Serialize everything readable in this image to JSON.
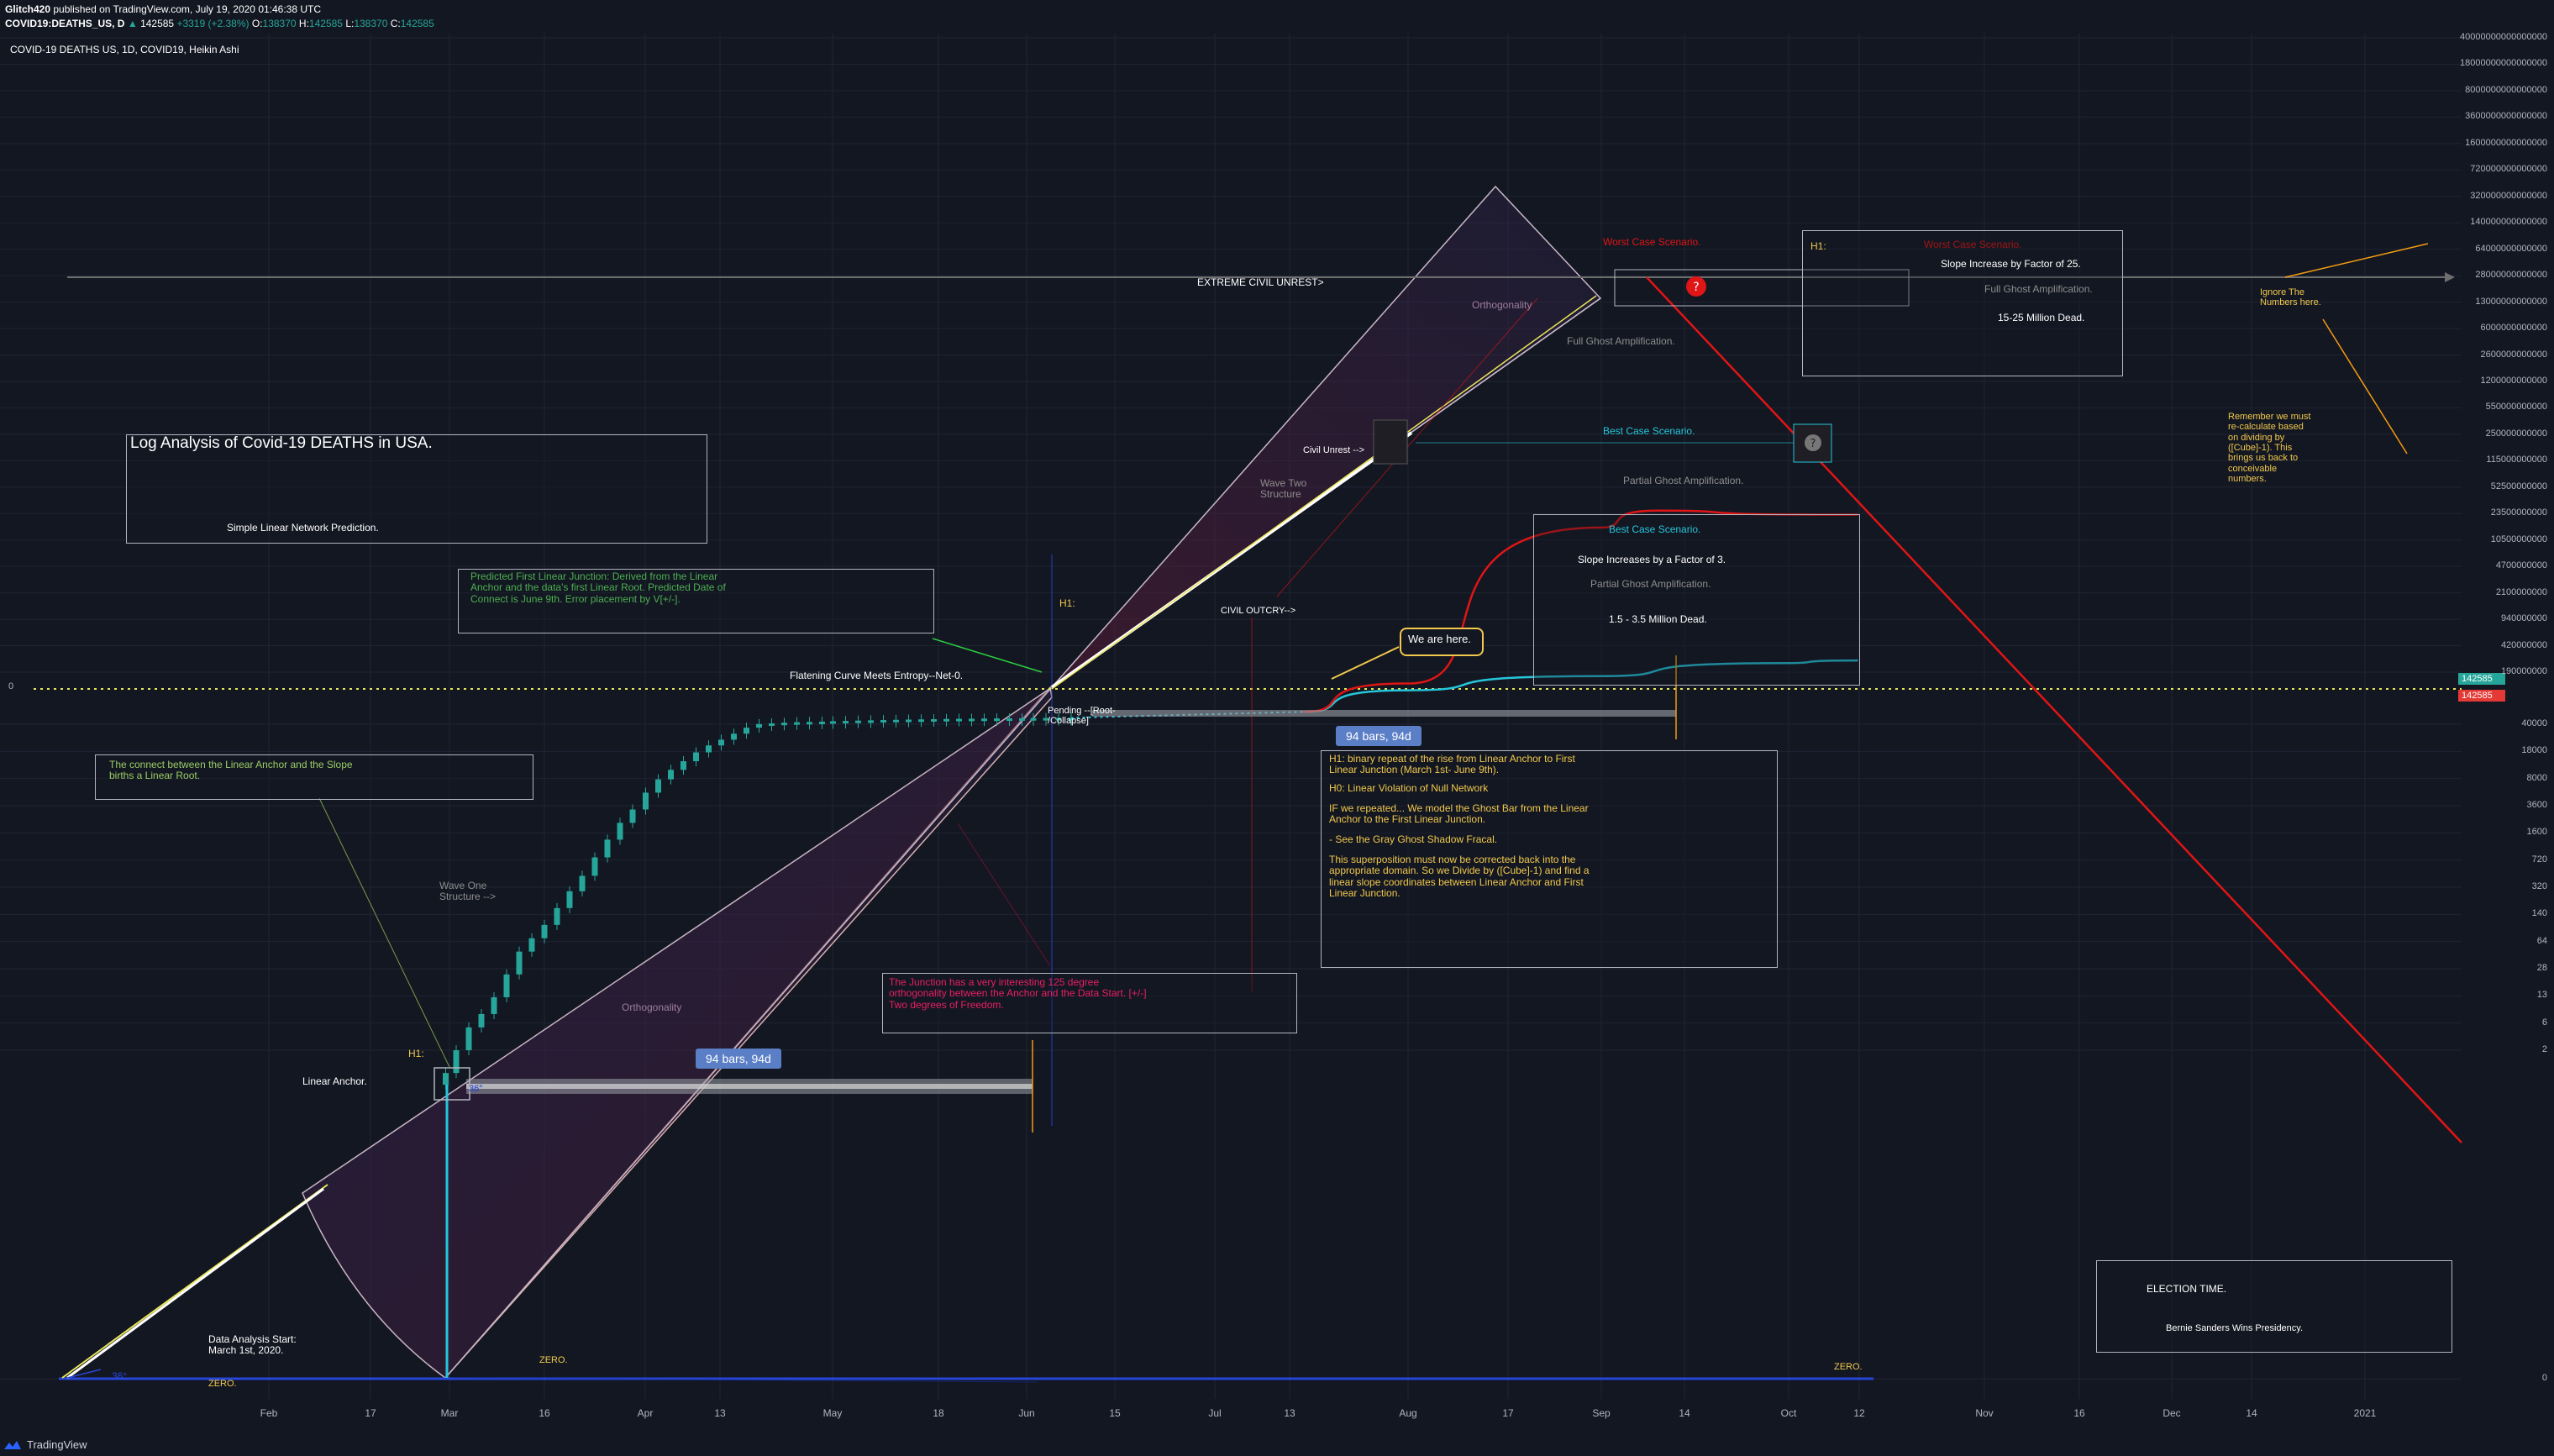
{
  "header": {
    "user": "Glitch420",
    "published": "published on TradingView.com, July 19, 2020 01:46:38 UTC",
    "symbol": "COVID19:DEATHS_US, D",
    "last": "142585",
    "change": "+3319 (+2.38%)",
    "o_label": "O:",
    "o": "138370",
    "h_label": "H:",
    "h": "142585",
    "l_label": "L:",
    "l": "138370",
    "c_label": "C:",
    "c": "142585"
  },
  "chart_title_line": "COVID-19 DEATHS US, 1D, COVID19, Heikin Ashi",
  "footer_brand": "TradingView",
  "colors": {
    "background": "#131722",
    "candle_up": "#26a69a",
    "grid": "#1f2433",
    "worst_case": "#e01515",
    "best_case": "#26c6da",
    "annotation_yellow": "#f2c94c",
    "annotation_green": "#4caf50",
    "annotation_pink": "#e91e63"
  },
  "chart_data": {
    "type": "candlestick",
    "style": "Heikin Ashi",
    "scale": "log",
    "series": [
      {
        "name": "COVID19:DEATHS_US",
        "x": [
          "Feb 29",
          "Mar 2",
          "Mar 4",
          "Mar 6",
          "Mar 8",
          "Mar 10",
          "Mar 12",
          "Mar 14",
          "Mar 16",
          "Mar 18",
          "Mar 20",
          "Mar 22",
          "Mar 24",
          "Mar 26",
          "Mar 28",
          "Mar 30",
          "Apr 1",
          "Apr 3",
          "Apr 5",
          "Apr 7",
          "Apr 9",
          "Apr 11",
          "Apr 13",
          "Apr 15",
          "Apr 17",
          "Apr 19",
          "Apr 21",
          "Apr 23",
          "Apr 25",
          "Apr 27",
          "Apr 29",
          "May 1",
          "May 3",
          "May 5",
          "May 7",
          "May 9",
          "May 11",
          "May 13",
          "May 15",
          "May 17",
          "May 19",
          "May 21",
          "May 23",
          "May 25",
          "May 27",
          "May 29",
          "May 31",
          "Jun 2",
          "Jun 4",
          "Jun 6",
          "Jun 8"
        ],
        "y": [
          1,
          2,
          4,
          6,
          10,
          20,
          40,
          60,
          90,
          150,
          250,
          400,
          700,
          1200,
          2000,
          3000,
          5000,
          7500,
          10000,
          13000,
          17000,
          21000,
          25000,
          30000,
          36000,
          41000,
          46000,
          51000,
          55000,
          58000,
          61000,
          65000,
          68000,
          72000,
          75000,
          79000,
          82000,
          85000,
          88000,
          91000,
          94000,
          96000,
          98000,
          100000,
          102000,
          104000,
          106000,
          108000,
          110000,
          112000,
          114000
        ]
      },
      {
        "name": "Best Case Scenario",
        "x": [
          "Jul 15",
          "Aug 1",
          "Sep 1",
          "Oct 1",
          "Oct 12"
        ],
        "y": [
          300000,
          10000000,
          100000000,
          250000000,
          270000000
        ]
      },
      {
        "name": "Worst Case Scenario",
        "x": [
          "Jul 15",
          "Aug 1",
          "Sep 1",
          "Sep 10",
          "Oct 12"
        ],
        "y": [
          300000,
          30000000,
          15000000000,
          25000000000,
          22000000000
        ]
      }
    ],
    "last_value": "142585",
    "y_tick_labels": [
      "40000000000000000",
      "18000000000000000",
      "8000000000000000",
      "3600000000000000",
      "1600000000000000",
      "720000000000000",
      "320000000000000",
      "140000000000000",
      "64000000000000",
      "28000000000000",
      "13000000000000",
      "6000000000000",
      "2600000000000",
      "1200000000000",
      "550000000000",
      "250000000000",
      "115000000000",
      "52500000000",
      "23500000000",
      "10500000000",
      "4700000000",
      "2100000000",
      "940000000",
      "420000000",
      "190000000",
      "40000",
      "18000",
      "8000",
      "3600",
      "1600",
      "720",
      "320",
      "140",
      "64",
      "28",
      "13",
      "6",
      "2",
      "0"
    ],
    "x_tick_labels": [
      "Feb",
      "17",
      "Mar",
      "16",
      "Apr",
      "13",
      "May",
      "18",
      "Jun",
      "15",
      "Jul",
      "13",
      "Aug",
      "17",
      "Sep",
      "14",
      "Oct",
      "12",
      "Nov",
      "16",
      "Dec",
      "14",
      "2021"
    ],
    "left_axis_label": "0"
  },
  "annotations": {
    "title": "Log Analysis of Covid-19 DEATHS in USA.",
    "subtitle": "Simple Linear Network Prediction.",
    "predicted": "Predicted First Linear Junction: Derived from the Linear\nAnchor and the data's first Linear Root. Predicted Date of\nConnect is June 9th. Error placement by V[+/-].",
    "connect": "The connect between the Linear Anchor and the Slope\nbirths a Linear Root.",
    "extreme_unrest": "EXTREME CIVIL UNREST>",
    "orthogonality_top": "Orthogonality",
    "orthogonality_mid": "Orthogonality",
    "full_ghost_amp": "Full Ghost Amplification.",
    "worst_case_label": "Worst Case Scenario.",
    "best_case_label": "Best Case Scenario.",
    "partial_ghost_amp": "Partial Ghost Amplification.",
    "civil_unrest": "Civil Unrest -->",
    "civil_outcry": "CIVIL OUTCRY-->",
    "wave_two": "Wave Two\nStructure",
    "wave_one": "Wave One\nStructure -->",
    "h1_mid": "H1:",
    "h1_anchor": "H1:",
    "linear_anchor": "Linear Anchor.",
    "flattening": "Flatening Curve Meets Entropy--Net-0.",
    "pending": "Pending --[Root-\n/Collapse]",
    "we_are_here": "We are here.",
    "bars_label_1": "94 bars, 94d",
    "bars_label_2": "94 bars, 94d",
    "junction": "The Junction has a very interesting 125 degree\northogonality between the Anchor and the Data Start. [+/-]\nTwo degrees of Freedom.",
    "h1_box": {
      "line1": "H1: binary repeat of the rise from Linear Anchor to First\nLinear Junction (March 1st- June 9th).",
      "line2": "H0: Linear Violation of Null Network",
      "line3": "IF we repeated... We model the Ghost Bar from the Linear\nAnchor to the First Linear Junction.",
      "line4": "- See the Gray Ghost Shadow Fracal.",
      "line5": "This superposition must now be corrected back into the\nappropriate domain. So we Divide by ([Cube]-1) and find a\nlinear slope coordinates between Linear Anchor and First\nLinear Junction."
    },
    "best_box": {
      "title": "Best Case Scenario.",
      "slope": "Slope Increases by a Factor of 3.",
      "amp": "Partial Ghost Amplification.",
      "dead": "1.5 - 3.5 Million Dead."
    },
    "worst_box": {
      "h1": "H1:",
      "title": "Worst Case Scenario.",
      "slope": "Slope Increase by Factor of 25.",
      "amp": "Full Ghost Amplification.",
      "dead": "15-25 Million Dead."
    },
    "ignore": "Ignore The\nNumbers here.",
    "remember": "Remember we must\nre-calculate based\non dividing by\n([Cube]-1). This\nbrings us back to\nconceivable\nnumbers.",
    "election_title": "ELECTION TIME.",
    "election_text": "Bernie Sanders Wins Presidency.",
    "data_start": "Data Analysis Start:\nMarch 1st, 2020.",
    "angle": "36°",
    "angle2": "36°",
    "zero_left": "ZERO.",
    "zero_mid": "ZERO.",
    "zero_right": "ZERO."
  }
}
